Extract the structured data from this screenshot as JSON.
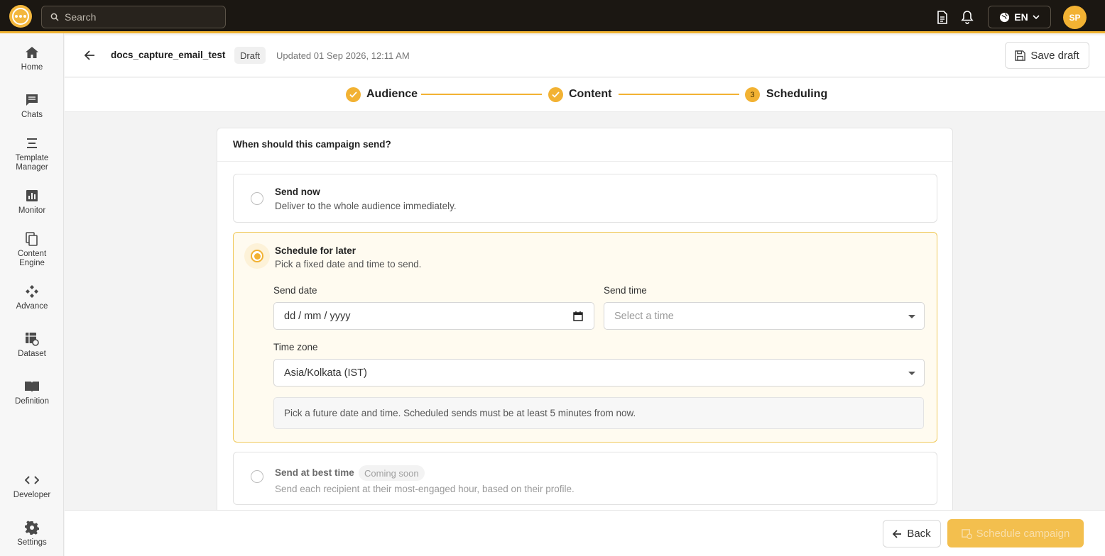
{
  "topbar": {
    "search_placeholder": "Search",
    "language": "EN",
    "avatar_initials": "SP"
  },
  "sidebar": {
    "items": [
      {
        "label": "Home",
        "icon": "home-icon"
      },
      {
        "label": "Chats",
        "icon": "chat-icon"
      },
      {
        "label": "Template\nManager",
        "icon": "template-icon"
      },
      {
        "label": "Monitor",
        "icon": "monitor-icon"
      },
      {
        "label": "Content\nEngine",
        "icon": "content-engine-icon"
      },
      {
        "label": "Advance",
        "icon": "advance-icon"
      },
      {
        "label": "Dataset",
        "icon": "dataset-icon"
      },
      {
        "label": "Definition",
        "icon": "definition-icon"
      },
      {
        "label": "Developer",
        "icon": "code-icon"
      },
      {
        "label": "Settings",
        "icon": "gear-icon"
      }
    ]
  },
  "header": {
    "campaign_name": "docs_capture_email_test",
    "status": "Draft",
    "updated": "Updated 01 Sep 2026, 12:11 AM",
    "save_label": "Save draft"
  },
  "stepper": {
    "steps": [
      {
        "label": "Audience",
        "state": "done"
      },
      {
        "label": "Content",
        "state": "done"
      },
      {
        "label": "Scheduling",
        "state": "current",
        "number": "3"
      }
    ]
  },
  "schedule": {
    "question": "When should this campaign send?",
    "options": [
      {
        "title": "Send now",
        "description": "Deliver to the whole audience immediately.",
        "selected": false
      },
      {
        "title": "Schedule for later",
        "description": "Pick a fixed date and time to send.",
        "selected": true
      },
      {
        "title": "Send at best time",
        "description": "Send each recipient at their most-engaged hour, based on their profile.",
        "selected": false,
        "badge": "Coming soon"
      }
    ],
    "send_date_label": "Send date",
    "send_date_placeholder": "dd / mm / yyyy",
    "send_time_label": "Send time",
    "send_time_placeholder": "Select a time",
    "timezone_label": "Time zone",
    "timezone_value": "Asia/Kolkata (IST)",
    "hint": "Pick a future date and time. Scheduled sends must be at least 5 minutes from now."
  },
  "footer": {
    "back_label": "Back",
    "schedule_label": "Schedule campaign"
  },
  "colors": {
    "accent": "#f2b233",
    "topbar": "#1b1712"
  }
}
